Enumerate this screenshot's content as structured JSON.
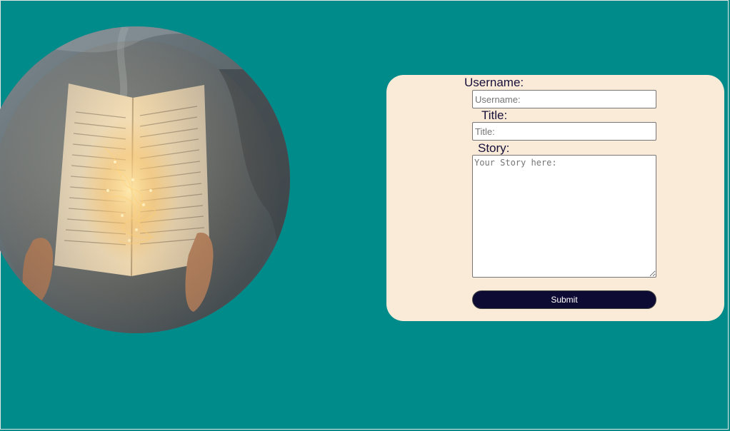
{
  "page": {
    "background_color": "#008b8b",
    "card_color": "#faebd8",
    "button_color": "#0d0a33"
  },
  "hero_image": {
    "alt": "book-with-fairy-lights-photo",
    "shape": "circle"
  },
  "form": {
    "username": {
      "label": "Username:",
      "placeholder": "Username:",
      "value": ""
    },
    "title": {
      "label": "Title:",
      "placeholder": "Title:",
      "value": ""
    },
    "story": {
      "label": "Story:",
      "placeholder": "Your Story here:",
      "value": ""
    },
    "submit_label": "Submit"
  }
}
